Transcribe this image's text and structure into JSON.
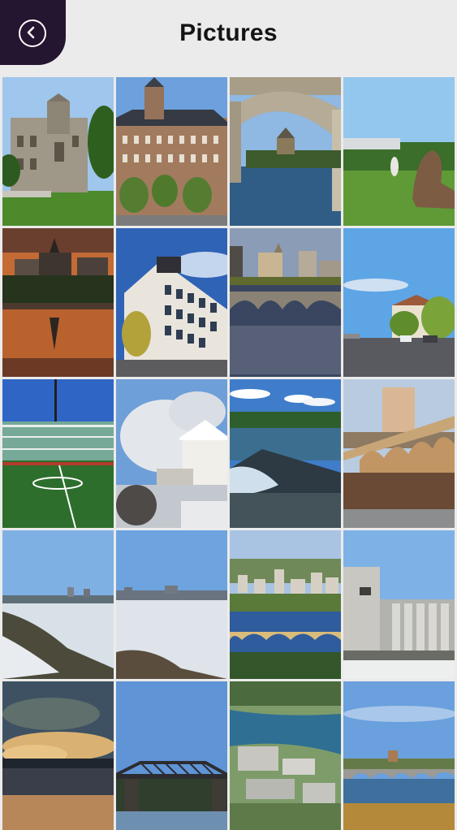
{
  "header": {
    "title": "Pictures",
    "back_icon": "chevron-left-circle-icon",
    "background": "#ebebeb",
    "back_button_color": "#241530"
  },
  "gallery": {
    "columns": 4,
    "photos": [
      {
        "name": "photo-university-building"
      },
      {
        "name": "photo-castle-hotel"
      },
      {
        "name": "photo-bridge-arch-castle"
      },
      {
        "name": "photo-park-sculpture"
      },
      {
        "name": "photo-sunset-castle-reflection"
      },
      {
        "name": "photo-modern-building"
      },
      {
        "name": "photo-bridge-skyline"
      },
      {
        "name": "photo-street-trees"
      },
      {
        "name": "photo-football-stadium"
      },
      {
        "name": "photo-frosted-trees"
      },
      {
        "name": "photo-river-weir"
      },
      {
        "name": "photo-arch-bridge-tower"
      },
      {
        "name": "photo-winter-river-1"
      },
      {
        "name": "photo-winter-river-2"
      },
      {
        "name": "photo-aerial-city-bridge"
      },
      {
        "name": "photo-grain-elevator"
      },
      {
        "name": "photo-cloudy-sunset"
      },
      {
        "name": "photo-steel-bridge"
      },
      {
        "name": "photo-aerial-river-town"
      },
      {
        "name": "photo-autumn-bridge"
      }
    ]
  }
}
